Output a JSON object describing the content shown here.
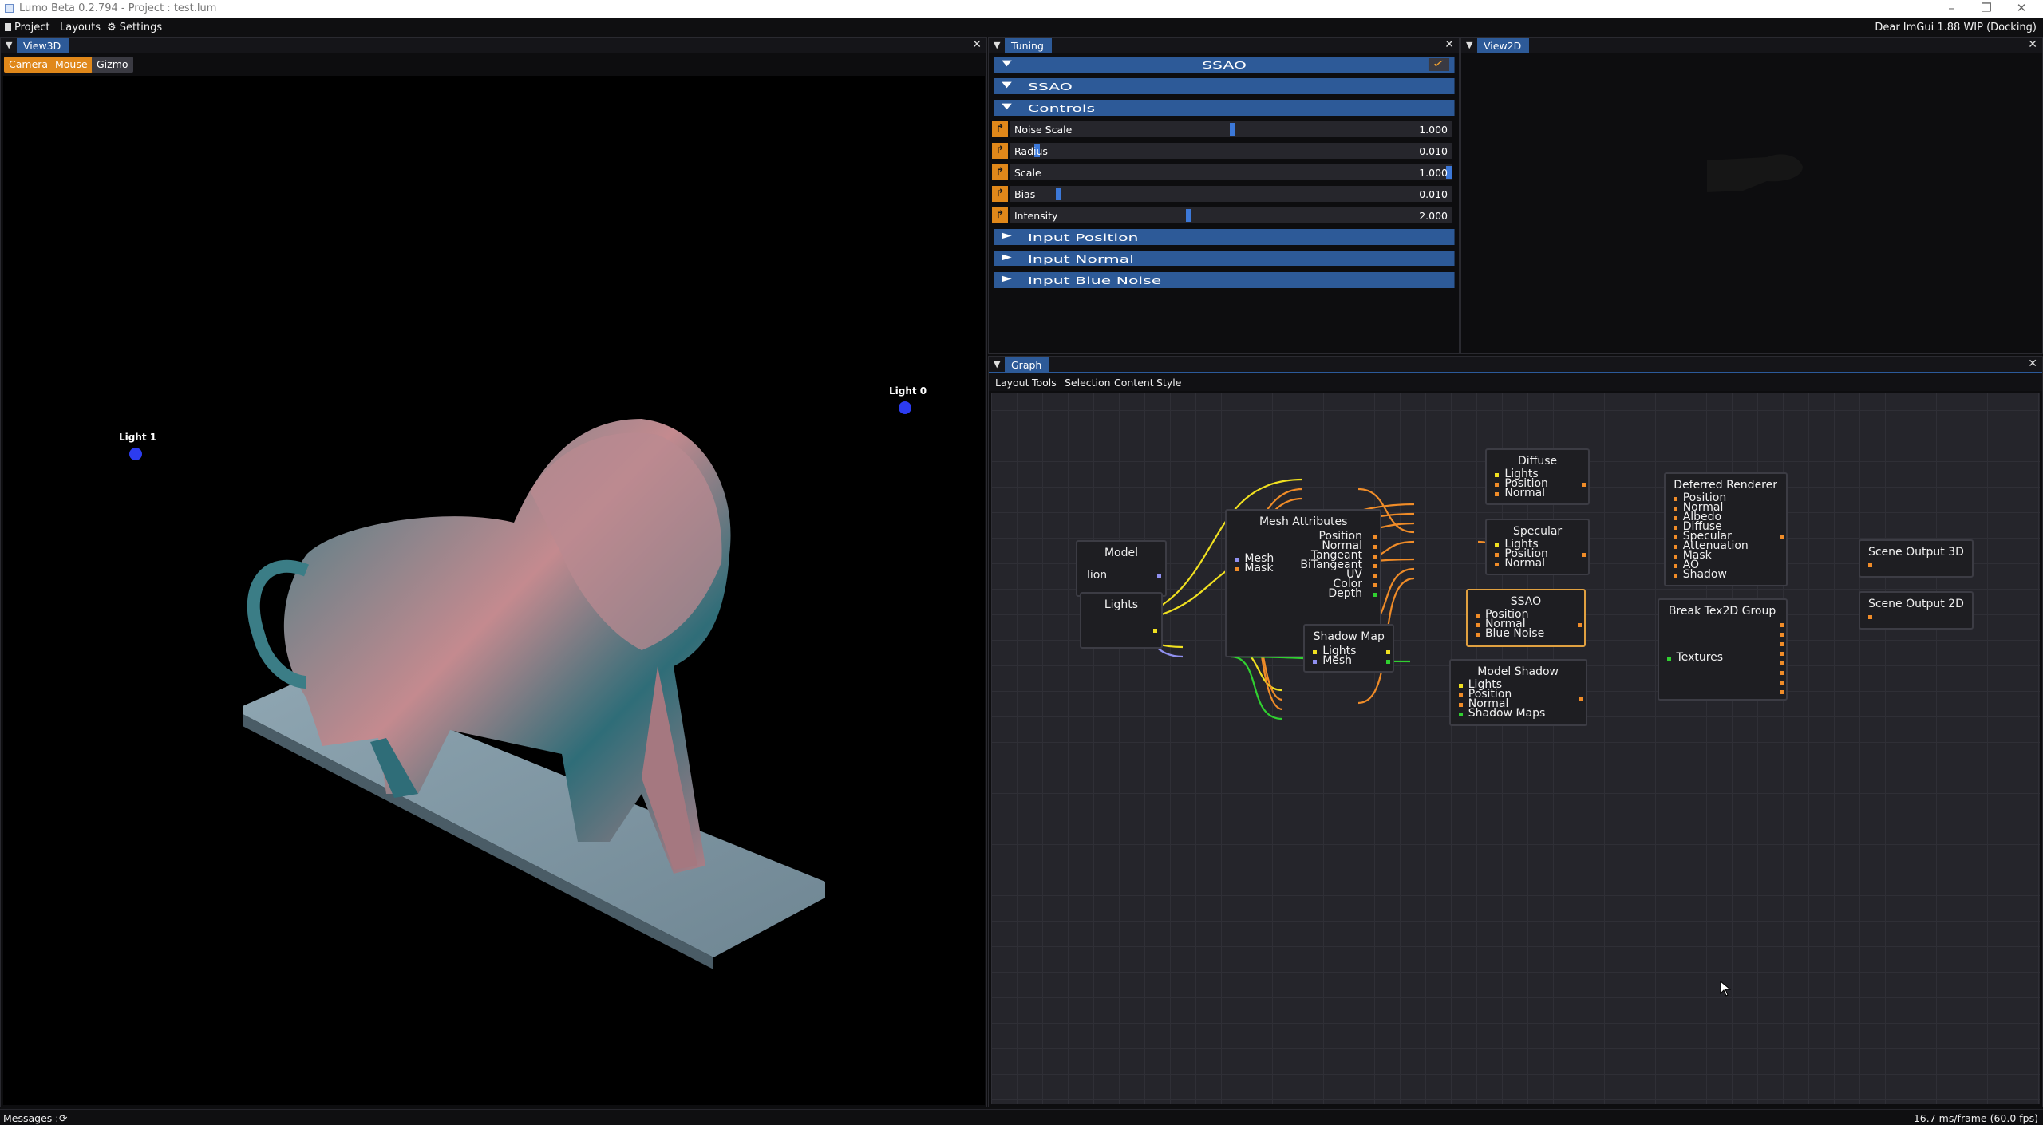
{
  "window": {
    "title": "Lumo Beta 0.2.794 - Project : test.lum",
    "minimize": "–",
    "restore": "❐",
    "close": "✕"
  },
  "menubar": {
    "project": "Project",
    "layouts": "Layouts",
    "settings": "Settings",
    "version": "Dear ImGui 1.88 WIP (Docking)"
  },
  "view3d": {
    "tab": "View3D",
    "buttons": {
      "camera": "Camera",
      "mouse": "Mouse",
      "gizmo": "Gizmo"
    },
    "lights": [
      {
        "label": "Light 0"
      },
      {
        "label": "Light 1"
      }
    ],
    "colors": {
      "light_dot": "#2c3cf0",
      "active_button": "#e0881a"
    }
  },
  "tuning": {
    "tab": "Tuning",
    "header": "SSAO",
    "enabled_check": "✓",
    "sections": {
      "ssao": "SSAO",
      "controls": "Controls",
      "input_position": "Input Position",
      "input_normal": "Input Normal",
      "input_blue_noise": "Input Blue Noise"
    },
    "controls": [
      {
        "label": "Noise Scale",
        "value": "1.000",
        "fraction": 0.5
      },
      {
        "label": "Radius",
        "value": "0.010",
        "fraction": 0.05
      },
      {
        "label": "Scale",
        "value": "1.000",
        "fraction": 1.0
      },
      {
        "label": "Bias",
        "value": "0.010",
        "fraction": 0.1
      },
      {
        "label": "Intensity",
        "value": "2.000",
        "fraction": 0.4
      }
    ]
  },
  "view2d": {
    "tab": "View2D"
  },
  "graph": {
    "tab": "Graph",
    "menu": {
      "layout": "Layout",
      "tools": "Tools",
      "selection": "Selection",
      "content": "Content",
      "style": "Style"
    },
    "nodes": {
      "model": {
        "title": "Model",
        "out": "lion"
      },
      "lights": {
        "title": "Lights"
      },
      "mesh_attributes": {
        "title": "Mesh Attributes",
        "in": [
          "Mesh",
          "Mask"
        ],
        "out": [
          "Position",
          "Normal",
          "Tangeant",
          "BiTangeant",
          "UV",
          "Color",
          "Depth"
        ]
      },
      "shadow_map": {
        "title": "Shadow Map",
        "in": [
          "Lights",
          "Mesh"
        ]
      },
      "diffuse": {
        "title": "Diffuse",
        "in": [
          "Lights",
          "Position",
          "Normal"
        ]
      },
      "specular": {
        "title": "Specular",
        "in": [
          "Lights",
          "Position",
          "Normal"
        ]
      },
      "ssao": {
        "title": "SSAO",
        "in": [
          "Position",
          "Normal",
          "Blue Noise"
        ]
      },
      "model_shadow": {
        "title": "Model Shadow",
        "in": [
          "Lights",
          "Position",
          "Normal",
          "Shadow Maps"
        ]
      },
      "deferred_renderer": {
        "title": "Deferred Renderer",
        "in": [
          "Position",
          "Normal",
          "Albedo",
          "Diffuse",
          "Specular",
          "Attenuation",
          "Mask",
          "AO",
          "Shadow"
        ]
      },
      "break_tex2d": {
        "title": "Break Tex2D Group",
        "in": [
          "Textures"
        ]
      },
      "scene_output_3d": {
        "title": "Scene Output 3D"
      },
      "scene_output_2d": {
        "title": "Scene Output 2D"
      }
    },
    "colors": {
      "link_orange": "#f08c28",
      "link_yellow": "#f0e020",
      "link_purple": "#9090f0",
      "link_green": "#30d030",
      "selected_border": "#e0a040"
    }
  },
  "statusbar": {
    "messages": "Messages :",
    "fps": "16.7 ms/frame (60.0 fps)"
  }
}
